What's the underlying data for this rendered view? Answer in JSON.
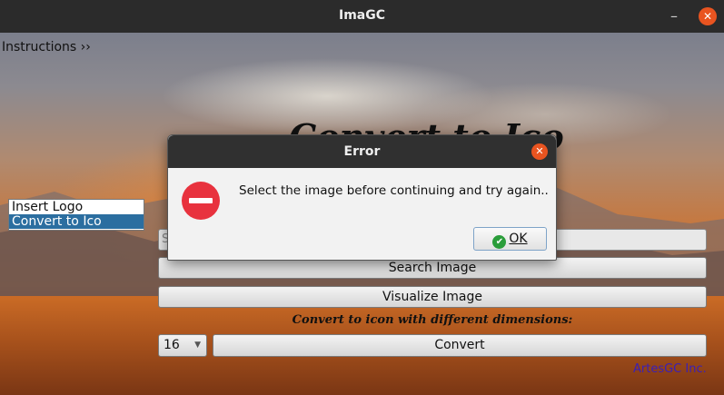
{
  "window": {
    "title": "ImaGC",
    "minimize_glyph": "–",
    "close_glyph": "✕"
  },
  "menu": {
    "instructions": "Instructions ››"
  },
  "heading": "Convert to Ico",
  "sidebar": {
    "items": [
      {
        "label": "Insert Logo"
      },
      {
        "label": "Convert to Ico"
      }
    ],
    "selected": "Convert to Ico"
  },
  "path_field": {
    "value": "S"
  },
  "buttons": {
    "search": "Search Image",
    "visualize": "Visualize Image",
    "convert": "Convert"
  },
  "dimensions_label": "Convert to icon with different dimensions:",
  "size_select": {
    "value": "16"
  },
  "footer": "ArtesGC Inc.",
  "dialog": {
    "title": "Error",
    "message": "Select the image before continuing and try again..",
    "ok_label": "OK",
    "close_glyph": "✕"
  },
  "colors": {
    "accent_close": "#e95420",
    "selection": "#2b6ea0",
    "footer_text": "#3a1fb8",
    "ok_check": "#2a9d3a",
    "error_icon": "#e8323e"
  }
}
